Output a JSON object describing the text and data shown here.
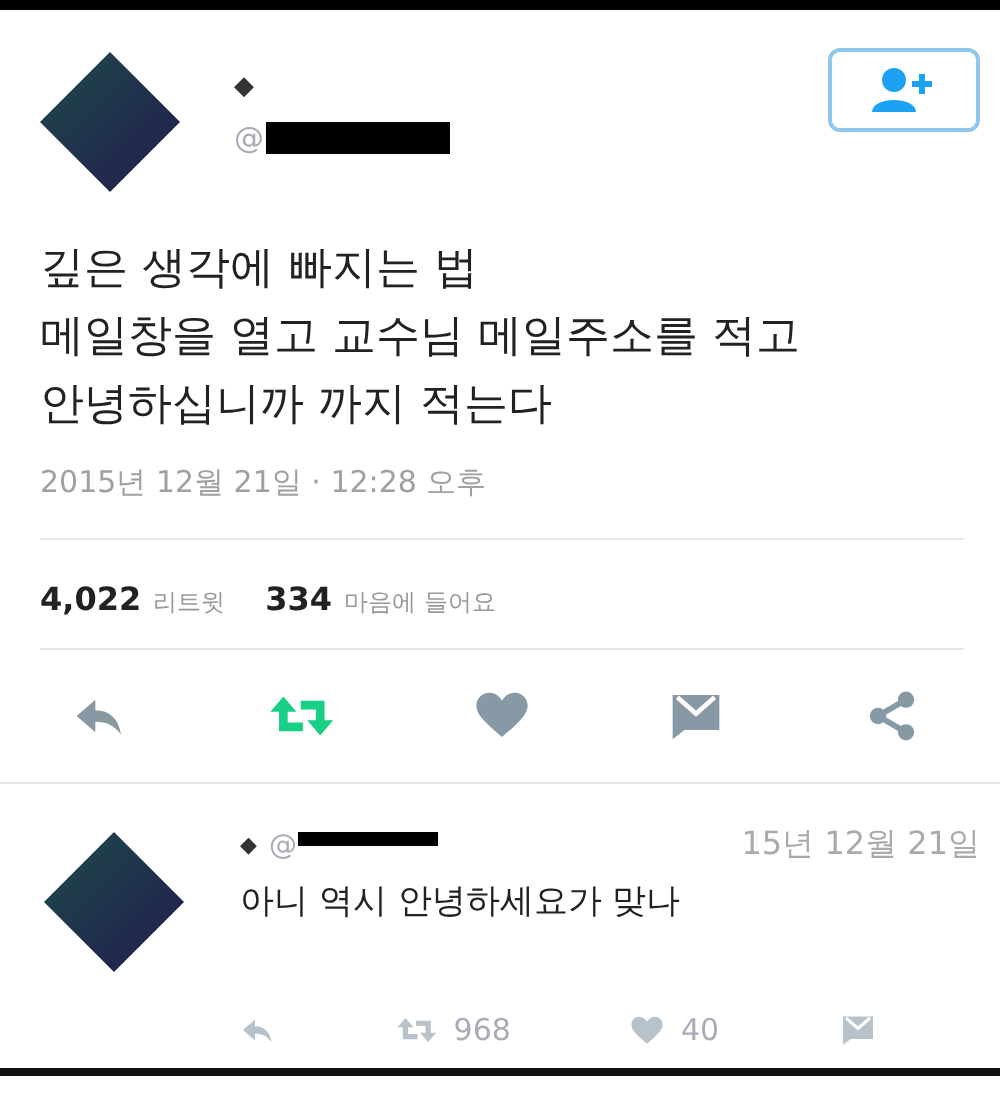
{
  "tweet": {
    "name": "◆",
    "handle_prefix": "@",
    "follow_button": true,
    "lines": [
      "깊은 생각에 빠지는 법",
      "메일창을 열고 교수님 메일주소를 적고",
      "안녕하십니까 까지 적는다"
    ],
    "timestamp": "2015년 12월 21일 · 12:28 오후",
    "stats": [
      {
        "count": "4,022",
        "label": "리트윗"
      },
      {
        "count": "334",
        "label": "마음에 들어요"
      }
    ],
    "retweeted": true
  },
  "reply": {
    "name": "◆",
    "handle_prefix": "@",
    "date": "15년 12월 21일",
    "text": "아니 역시 안녕하세요가 맞나",
    "retweet_count": "968",
    "like_count": "40",
    "retweeted": false
  }
}
